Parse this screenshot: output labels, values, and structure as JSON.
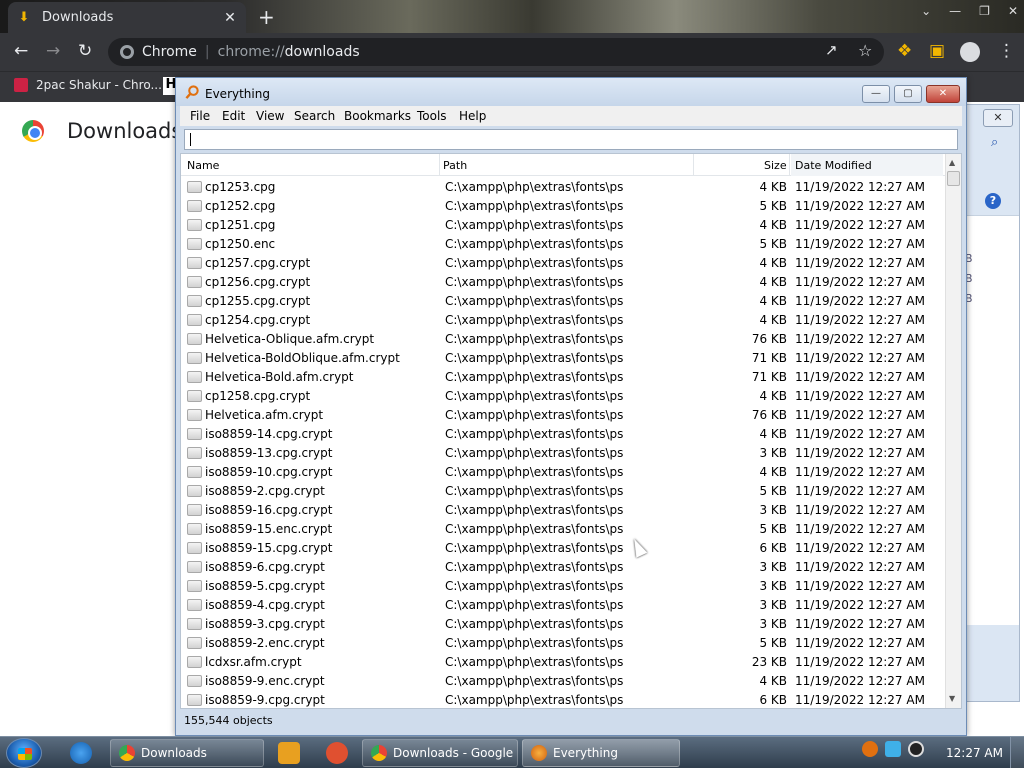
{
  "chrome": {
    "tab_label": "Downloads",
    "url_site": "Chrome",
    "url_scheme": "chrome://",
    "url_host": "downloads",
    "bookmark1": "2pac Shakur - Chro...",
    "bookmark2": "H",
    "page_title": "Downloads"
  },
  "everything": {
    "title": "Everything",
    "menus": [
      "File",
      "Edit",
      "View",
      "Search",
      "Bookmarks",
      "Tools",
      "Help"
    ],
    "search_value": "",
    "columns": {
      "name": "Name",
      "path": "Path",
      "size": "Size",
      "date": "Date Modified"
    },
    "rows": [
      {
        "name": "cp1253.cpg",
        "path": "C:\\xampp\\php\\extras\\fonts\\ps",
        "size": "4 KB",
        "date": "11/19/2022 12:27 AM"
      },
      {
        "name": "cp1252.cpg",
        "path": "C:\\xampp\\php\\extras\\fonts\\ps",
        "size": "5 KB",
        "date": "11/19/2022 12:27 AM"
      },
      {
        "name": "cp1251.cpg",
        "path": "C:\\xampp\\php\\extras\\fonts\\ps",
        "size": "4 KB",
        "date": "11/19/2022 12:27 AM"
      },
      {
        "name": "cp1250.enc",
        "path": "C:\\xampp\\php\\extras\\fonts\\ps",
        "size": "5 KB",
        "date": "11/19/2022 12:27 AM"
      },
      {
        "name": "cp1257.cpg.crypt",
        "path": "C:\\xampp\\php\\extras\\fonts\\ps",
        "size": "4 KB",
        "date": "11/19/2022 12:27 AM"
      },
      {
        "name": "cp1256.cpg.crypt",
        "path": "C:\\xampp\\php\\extras\\fonts\\ps",
        "size": "4 KB",
        "date": "11/19/2022 12:27 AM"
      },
      {
        "name": "cp1255.cpg.crypt",
        "path": "C:\\xampp\\php\\extras\\fonts\\ps",
        "size": "4 KB",
        "date": "11/19/2022 12:27 AM"
      },
      {
        "name": "cp1254.cpg.crypt",
        "path": "C:\\xampp\\php\\extras\\fonts\\ps",
        "size": "4 KB",
        "date": "11/19/2022 12:27 AM"
      },
      {
        "name": "Helvetica-Oblique.afm.crypt",
        "path": "C:\\xampp\\php\\extras\\fonts\\ps",
        "size": "76 KB",
        "date": "11/19/2022 12:27 AM"
      },
      {
        "name": "Helvetica-BoldOblique.afm.crypt",
        "path": "C:\\xampp\\php\\extras\\fonts\\ps",
        "size": "71 KB",
        "date": "11/19/2022 12:27 AM"
      },
      {
        "name": "Helvetica-Bold.afm.crypt",
        "path": "C:\\xampp\\php\\extras\\fonts\\ps",
        "size": "71 KB",
        "date": "11/19/2022 12:27 AM"
      },
      {
        "name": "cp1258.cpg.crypt",
        "path": "C:\\xampp\\php\\extras\\fonts\\ps",
        "size": "4 KB",
        "date": "11/19/2022 12:27 AM"
      },
      {
        "name": "Helvetica.afm.crypt",
        "path": "C:\\xampp\\php\\extras\\fonts\\ps",
        "size": "76 KB",
        "date": "11/19/2022 12:27 AM"
      },
      {
        "name": "iso8859-14.cpg.crypt",
        "path": "C:\\xampp\\php\\extras\\fonts\\ps",
        "size": "4 KB",
        "date": "11/19/2022 12:27 AM"
      },
      {
        "name": "iso8859-13.cpg.crypt",
        "path": "C:\\xampp\\php\\extras\\fonts\\ps",
        "size": "3 KB",
        "date": "11/19/2022 12:27 AM"
      },
      {
        "name": "iso8859-10.cpg.crypt",
        "path": "C:\\xampp\\php\\extras\\fonts\\ps",
        "size": "4 KB",
        "date": "11/19/2022 12:27 AM"
      },
      {
        "name": "iso8859-2.cpg.crypt",
        "path": "C:\\xampp\\php\\extras\\fonts\\ps",
        "size": "5 KB",
        "date": "11/19/2022 12:27 AM"
      },
      {
        "name": "iso8859-16.cpg.crypt",
        "path": "C:\\xampp\\php\\extras\\fonts\\ps",
        "size": "3 KB",
        "date": "11/19/2022 12:27 AM"
      },
      {
        "name": "iso8859-15.enc.crypt",
        "path": "C:\\xampp\\php\\extras\\fonts\\ps",
        "size": "5 KB",
        "date": "11/19/2022 12:27 AM"
      },
      {
        "name": "iso8859-15.cpg.crypt",
        "path": "C:\\xampp\\php\\extras\\fonts\\ps",
        "size": "6 KB",
        "date": "11/19/2022 12:27 AM"
      },
      {
        "name": "iso8859-6.cpg.crypt",
        "path": "C:\\xampp\\php\\extras\\fonts\\ps",
        "size": "3 KB",
        "date": "11/19/2022 12:27 AM"
      },
      {
        "name": "iso8859-5.cpg.crypt",
        "path": "C:\\xampp\\php\\extras\\fonts\\ps",
        "size": "3 KB",
        "date": "11/19/2022 12:27 AM"
      },
      {
        "name": "iso8859-4.cpg.crypt",
        "path": "C:\\xampp\\php\\extras\\fonts\\ps",
        "size": "3 KB",
        "date": "11/19/2022 12:27 AM"
      },
      {
        "name": "iso8859-3.cpg.crypt",
        "path": "C:\\xampp\\php\\extras\\fonts\\ps",
        "size": "3 KB",
        "date": "11/19/2022 12:27 AM"
      },
      {
        "name": "iso8859-2.enc.crypt",
        "path": "C:\\xampp\\php\\extras\\fonts\\ps",
        "size": "5 KB",
        "date": "11/19/2022 12:27 AM"
      },
      {
        "name": "lcdxsr.afm.crypt",
        "path": "C:\\xampp\\php\\extras\\fonts\\ps",
        "size": "23 KB",
        "date": "11/19/2022 12:27 AM"
      },
      {
        "name": "iso8859-9.enc.crypt",
        "path": "C:\\xampp\\php\\extras\\fonts\\ps",
        "size": "4 KB",
        "date": "11/19/2022 12:27 AM"
      },
      {
        "name": "iso8859-9.cpg.crypt",
        "path": "C:\\xampp\\php\\extras\\fonts\\ps",
        "size": "6 KB",
        "date": "11/19/2022 12:27 AM"
      }
    ],
    "status": "155,544 objects"
  },
  "background_window": {
    "partial_text": [
      "B",
      "B",
      "B"
    ]
  },
  "taskbar": {
    "buttons": [
      "Downloads",
      "Downloads - Google ...",
      "Everything"
    ],
    "clock": "12:27 AM"
  },
  "colors": {
    "chrome_toolbar": "#35363a",
    "taskbar": "#2f3d4c",
    "everything_frame": "#cfdcec"
  }
}
